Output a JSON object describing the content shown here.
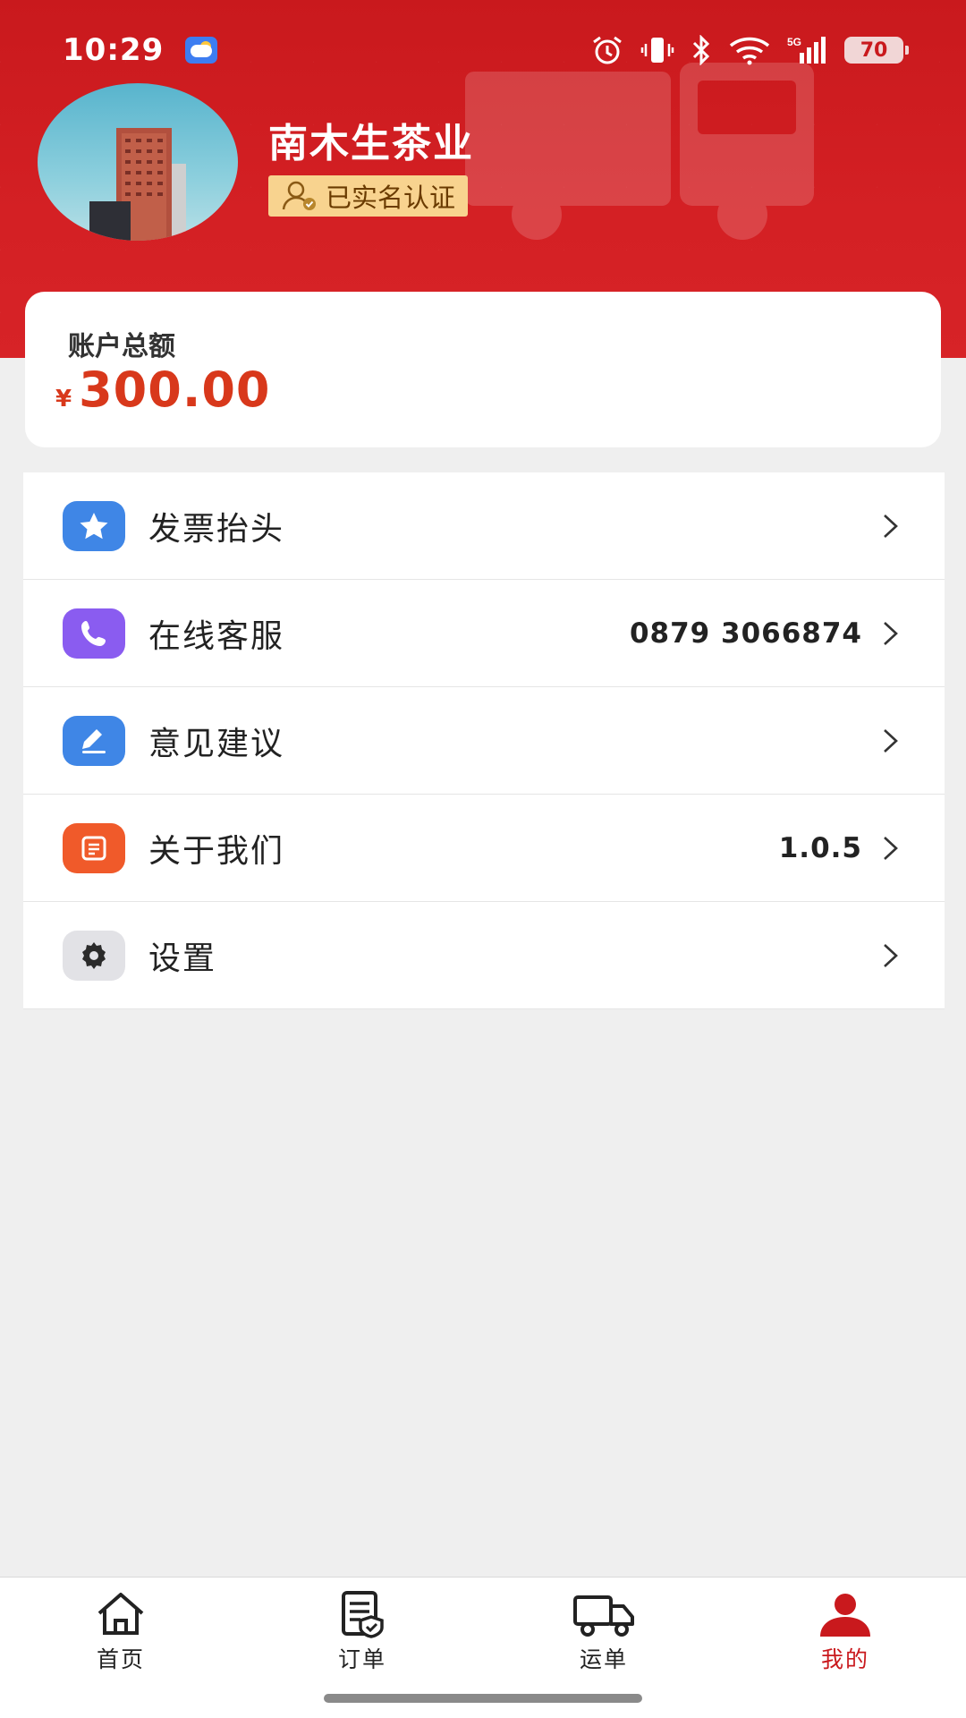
{
  "status_bar": {
    "time": "10:29",
    "network": "5G",
    "battery": "70",
    "icons": [
      "weather-icon",
      "alarm-icon",
      "vibrate-icon",
      "bluetooth-icon",
      "wifi-icon",
      "signal-icon",
      "battery-icon"
    ]
  },
  "profile": {
    "company_name": "南木生茶业",
    "verified_label": "已实名认证"
  },
  "account": {
    "label": "账户总额",
    "currency": "¥",
    "amount": "300.00"
  },
  "menu": {
    "items": [
      {
        "label": "发票抬头",
        "value": "",
        "icon": "star-icon",
        "icon_color": "#3f86e6"
      },
      {
        "label": "在线客服",
        "value": "0879 3066874",
        "icon": "phone-icon",
        "icon_color": "#8a5cf0"
      },
      {
        "label": "意见建议",
        "value": "",
        "icon": "edit-icon",
        "icon_color": "#3f86e6"
      },
      {
        "label": "关于我们",
        "value": "1.0.5",
        "icon": "info-doc-icon",
        "icon_color": "#f05a2a"
      },
      {
        "label": "设置",
        "value": "",
        "icon": "gear-icon",
        "icon_color": "#e2e2e6"
      }
    ]
  },
  "bottom_nav": {
    "items": [
      {
        "label": "首页",
        "icon": "home-icon",
        "active": false
      },
      {
        "label": "订单",
        "icon": "order-icon",
        "active": false
      },
      {
        "label": "运单",
        "icon": "truck-icon",
        "active": false
      },
      {
        "label": "我的",
        "icon": "user-icon",
        "active": true
      }
    ]
  },
  "colors": {
    "brand_red": "#c9191d",
    "amount_red": "#d8381b",
    "badge_gold": "#f8d38f"
  }
}
